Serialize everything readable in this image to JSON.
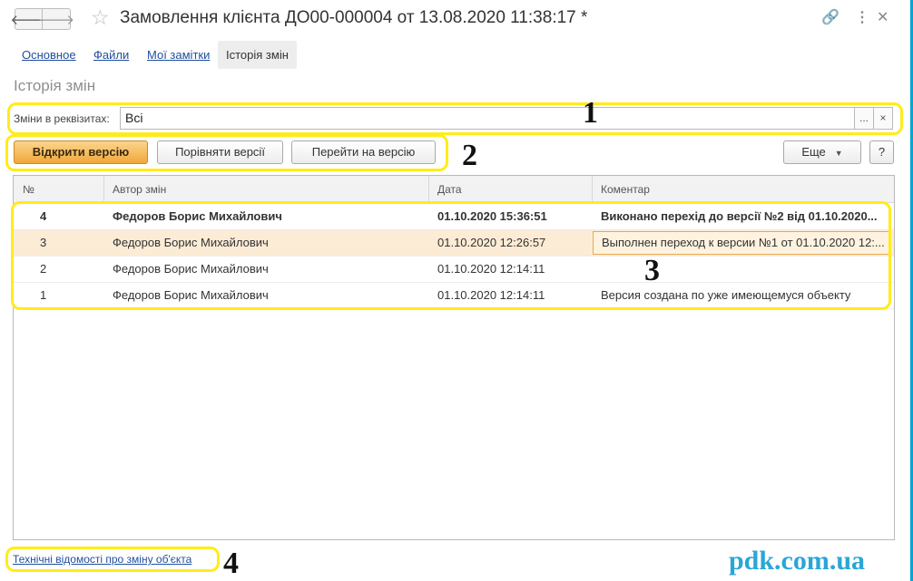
{
  "window": {
    "title": "Замовлення клієнта ДО00-000004 от 13.08.2020 11:38:17 *",
    "back_icon": "arrow-left-icon",
    "forward_icon": "arrow-right-icon",
    "favorite_icon": "star-icon",
    "link_icon": "link-icon",
    "menu_icon": "more-icon",
    "close_icon": "close-icon",
    "glyphs": {
      "back": "🡐",
      "forward": "🡒",
      "star": "☆",
      "link": "🔗",
      "more": "⋮",
      "close": "✕"
    }
  },
  "tabs": [
    {
      "label": "Основное",
      "active": false
    },
    {
      "label": "Файли",
      "active": false
    },
    {
      "label": "Мої замітки",
      "active": false
    },
    {
      "label": "Історія змін",
      "active": true
    }
  ],
  "section_title": "Історія змін",
  "filter": {
    "label": "Зміни в реквізитах:",
    "value": "Всі",
    "select_button": "...",
    "clear_button": "×"
  },
  "toolbar": {
    "open_version": "Відкрити версію",
    "compare_versions": "Порівняти версії",
    "go_to_version": "Перейти на версію",
    "more": "Еще",
    "more_caret": "▼",
    "help": "?"
  },
  "table": {
    "columns": [
      "№",
      "Автор змін",
      "Дата",
      "Коментар"
    ],
    "rows": [
      {
        "num": "4",
        "author": "Федоров Борис Михайлович",
        "date": "01.10.2020 15:36:51",
        "comment": "Виконано перехід до версії №2 від 01.10.2020...",
        "bold": true
      },
      {
        "num": "3",
        "author": "Федоров Борис Михайлович",
        "date": "01.10.2020 12:26:57",
        "comment": "Выполнен переход к версии №1 от 01.10.2020 12:...",
        "selected": true
      },
      {
        "num": "2",
        "author": "Федоров Борис Михайлович",
        "date": "01.10.2020 12:14:11",
        "comment": ""
      },
      {
        "num": "1",
        "author": "Федоров Борис Михайлович",
        "date": "01.10.2020 12:14:11",
        "comment": "Версия создана по уже имеющемуся объекту"
      }
    ]
  },
  "footer_link": "Технічні відомості про зміну об'єкта",
  "watermark": "pdk.com.ua",
  "annotations": {
    "color": "#ffec1a",
    "labels": [
      "1",
      "2",
      "3",
      "4"
    ]
  }
}
